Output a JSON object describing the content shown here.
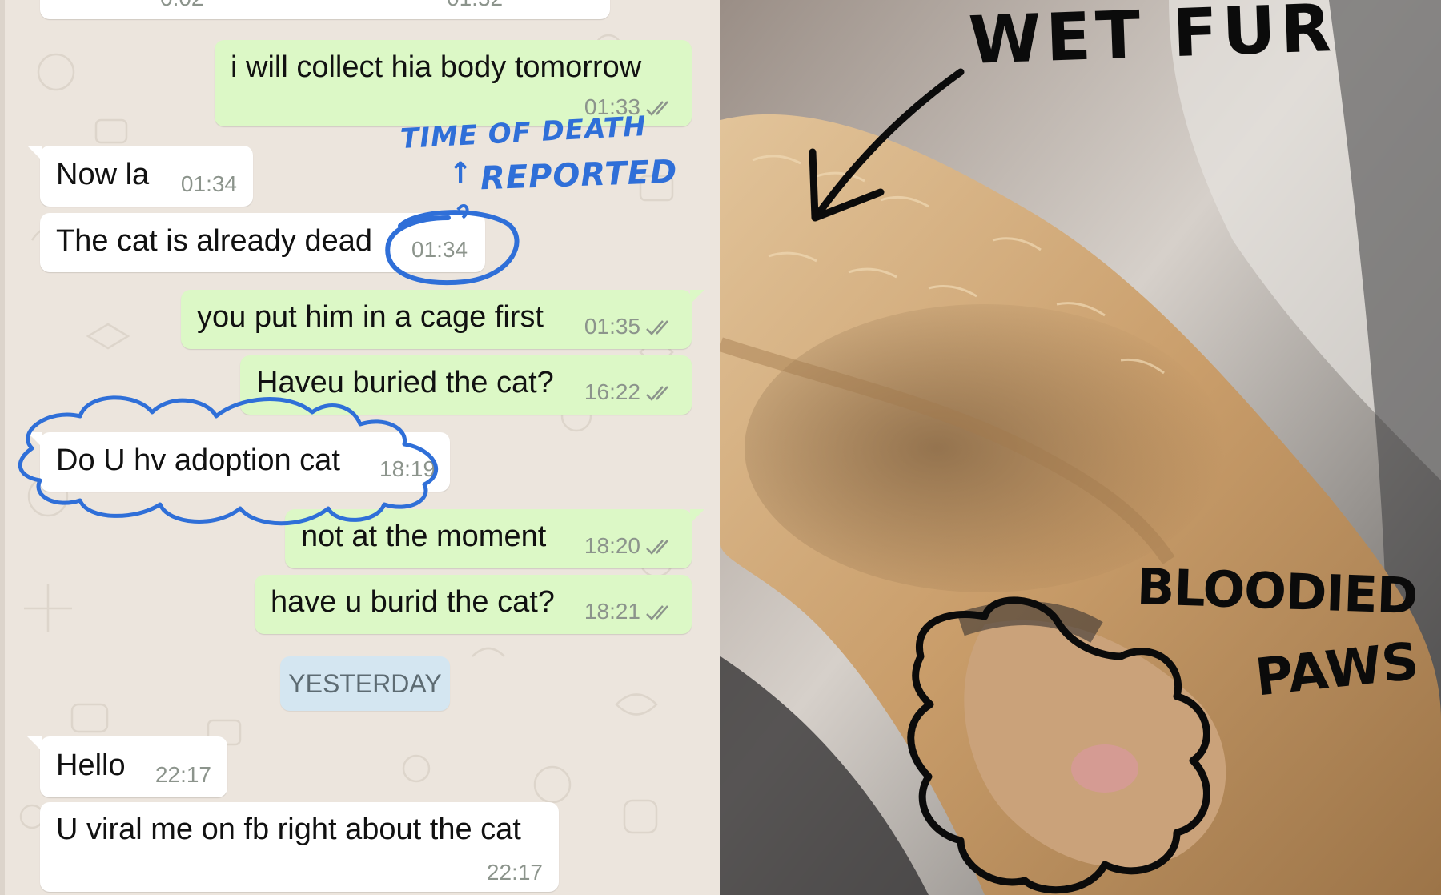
{
  "chat": {
    "top_partial": {
      "left_time": "0:02",
      "right_time": "01:32"
    },
    "messages": [
      {
        "dir": "out",
        "text": "i will collect hia body tomorrow",
        "time": "01:33",
        "ticks": true
      },
      {
        "dir": "in",
        "text": "Now la",
        "time": "01:34"
      },
      {
        "dir": "in",
        "text": "The cat is already dead",
        "time": "01:34"
      },
      {
        "dir": "out",
        "text": "you put him in a cage first",
        "time": "01:35",
        "ticks": true
      },
      {
        "dir": "out",
        "text": "Haveu buried the cat?",
        "time": "16:22",
        "ticks": true
      },
      {
        "dir": "in",
        "text": "Do U hv adoption cat",
        "time": "18:19"
      },
      {
        "dir": "out",
        "text": "not at the moment",
        "time": "18:20",
        "ticks": true
      },
      {
        "dir": "out",
        "text": "have u burid the cat?",
        "time": "18:21",
        "ticks": true
      },
      {
        "dir": "in",
        "text": "Hello",
        "time": "22:17"
      },
      {
        "dir": "in",
        "text": "U viral me on fb right about the cat",
        "time": "22:17"
      }
    ],
    "date_divider": "YESTERDAY",
    "annotations": {
      "time_of_death_line1": "TIME OF DEATH",
      "time_of_death_line2": "REPORTED",
      "arrow_glyph": "↑"
    }
  },
  "photo": {
    "labels": {
      "wet_fur": "WET FUR",
      "bloodied": "BLOODIED",
      "paws": "PAWS"
    },
    "colors": {
      "fur_light": "#d7b284",
      "fur_mid": "#b98a5a",
      "fur_shadow": "#8c6a45",
      "background_grey": "#6d6a67",
      "background_light": "#cfc9c2",
      "ink": "#0b0b0b"
    }
  },
  "colors": {
    "chat_background": "#ece5dd",
    "outgoing_bubble": "#dcf8c6",
    "incoming_bubble": "#ffffff",
    "date_chip": "#d4e6f1",
    "annotation_blue": "#2f6fd8",
    "read_tick": "#8c948c"
  },
  "icons": [
    "double-check-icon",
    "hand-drawn-arrow-icon",
    "hand-drawn-circle-icon"
  ]
}
